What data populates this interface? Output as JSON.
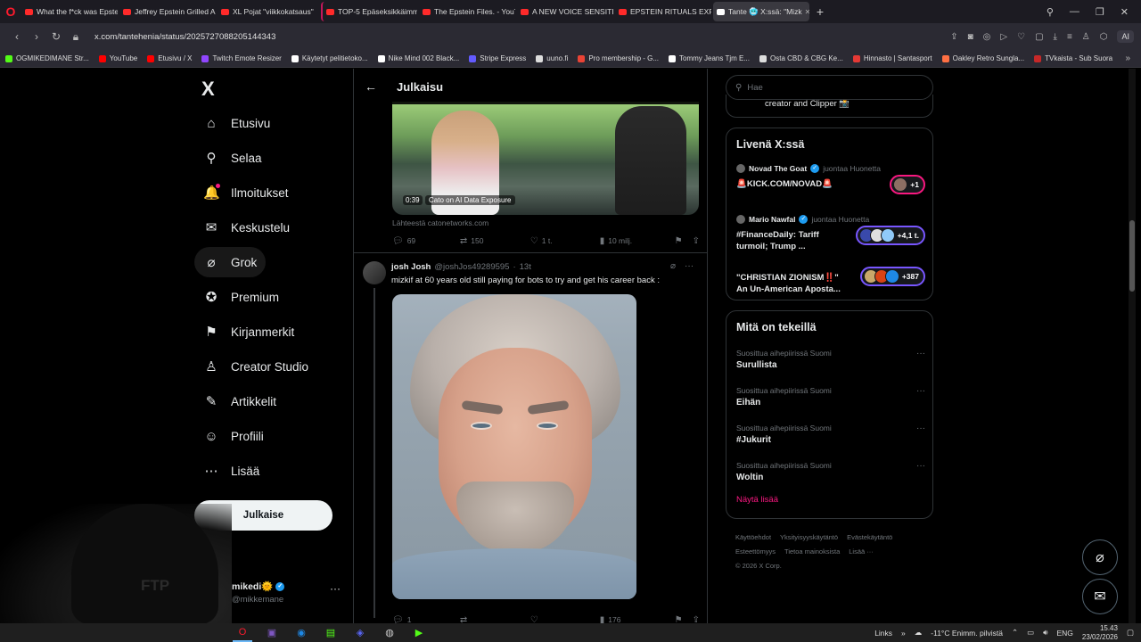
{
  "browser": {
    "tabs": [
      {
        "label": "What the f*ck was Epstein",
        "kind": "yt"
      },
      {
        "label": "Jeffrey Epstein Grilled Abo",
        "kind": "yt"
      },
      {
        "label": "XL Pojat \"viikkokatsaus\" 2",
        "kind": "yt"
      },
      {
        "label": "TOP-5 Epäseksikkäimmät",
        "kind": "yt"
      },
      {
        "label": "The Epstein Files. - YouTu",
        "kind": "yt"
      },
      {
        "label": "A NEW VOICE SENSITIVE S",
        "kind": "yt"
      },
      {
        "label": "EPSTEIN RITUALS EXPOSED",
        "kind": "yt"
      },
      {
        "label": "Tante 🥶 X:ssä: \"Mizk",
        "kind": "x"
      }
    ],
    "new_tab": "+",
    "url": "x.com/tantehenia/status/2025727088205144343",
    "ai_label": "AI",
    "bookmarks": [
      {
        "label": "OGMIKEDIMANE Str...",
        "color": "#53fc18"
      },
      {
        "label": "YouTube",
        "color": "#ff0000"
      },
      {
        "label": "Etusivu / X",
        "color": "#ff0000"
      },
      {
        "label": "Twitch Emote Resizer",
        "color": "#9146ff"
      },
      {
        "label": "Käytetyt pelitietoko...",
        "color": "#ffffff"
      },
      {
        "label": "Nike Mind 002 Black...",
        "color": "#ffffff"
      },
      {
        "label": "Stripe Express",
        "color": "#635bff"
      },
      {
        "label": "uuno.fi",
        "color": "#dddddd"
      },
      {
        "label": "Pro membership - G...",
        "color": "#ea4335"
      },
      {
        "label": "Tommy Jeans Tjm E...",
        "color": "#ffffff"
      },
      {
        "label": "Osta CBD & CBG Ke...",
        "color": "#dddddd"
      },
      {
        "label": "Hinnasto | Santasport",
        "color": "#e53935"
      },
      {
        "label": "Oakley Retro Sungla...",
        "color": "#ff7043"
      },
      {
        "label": "TVkaista - Sub Suora",
        "color": "#c62828"
      }
    ]
  },
  "leftnav": {
    "logo": "X",
    "items": [
      {
        "label": "Etusivu",
        "icon": "home-icon",
        "glyph": "⌂"
      },
      {
        "label": "Selaa",
        "icon": "search-icon",
        "glyph": "⚲"
      },
      {
        "label": "Ilmoitukset",
        "icon": "bell-icon",
        "glyph": "🔔"
      },
      {
        "label": "Keskustelu",
        "icon": "mail-icon",
        "glyph": "✉"
      },
      {
        "label": "Grok",
        "icon": "grok-icon",
        "glyph": "⌀"
      },
      {
        "label": "Premium",
        "icon": "premium-icon",
        "glyph": "✪"
      },
      {
        "label": "Kirjanmerkit",
        "icon": "bookmark-icon",
        "glyph": "⚑"
      },
      {
        "label": "Creator Studio",
        "icon": "creator-studio-icon",
        "glyph": "♙"
      },
      {
        "label": "Artikkelit",
        "icon": "articles-icon",
        "glyph": "✎"
      },
      {
        "label": "Profiili",
        "icon": "profile-icon",
        "glyph": "☺"
      },
      {
        "label": "Lisää",
        "icon": "more-icon",
        "glyph": "⋯"
      }
    ],
    "post_button": "Julkaise",
    "user": {
      "name": "mikedi🌞",
      "handle": "@mikkemane",
      "more": "···"
    }
  },
  "main": {
    "header": "Julkaisu",
    "tweet1": {
      "video_time": "0:39",
      "video_caption": "Cato on AI Data Exposure",
      "source": "Lähteestä catonetworks.com",
      "replies": "69",
      "reposts": "150",
      "likes": "1 t.",
      "views": "10 milj."
    },
    "tweet2": {
      "name": "josh Josh",
      "handle": "@joshJos49289595",
      "time": "13t",
      "text": "mizkif at 60 years old still paying for bots to try and get his career back :",
      "replies": "1",
      "reposts": "",
      "likes": "",
      "views": "176"
    }
  },
  "sidebar": {
    "search_placeholder": "Hae",
    "prev_text": "creator and Clipper 📸",
    "live": {
      "title": "Livenä X:ssä",
      "items": [
        {
          "host": "Novad The Goat",
          "role": "juontaa Huonetta",
          "title": "🚨KICK.COM/NOVAD🚨",
          "count": "+1",
          "pink": true,
          "avatars": [
            "#8d6e63"
          ]
        },
        {
          "host": "Mario Nawfal",
          "role": "juontaa Huonetta",
          "title": "#FinanceDaily: Tariff turmoil; Trump ...",
          "count": "+4,1 t.",
          "pink": false,
          "avatars": [
            "#3949ab",
            "#e0e0e0",
            "#90caf9"
          ]
        },
        {
          "host": "",
          "role": "",
          "title": "\"CHRISTIAN ZIONISM‼️\" An Un-American Aposta...",
          "count": "+387",
          "pink": false,
          "avatars": [
            "#c9a86a",
            "#d84315",
            "#1e88e5"
          ]
        }
      ]
    },
    "trends": {
      "title": "Mitä on tekeillä",
      "items": [
        {
          "category": "Suosittua aihepiirissä Suomi",
          "name": "Surullista"
        },
        {
          "category": "Suosittua aihepiirissä Suomi",
          "name": "Eihän"
        },
        {
          "category": "Suosittua aihepiirissä Suomi",
          "name": "#Jukurit"
        },
        {
          "category": "Suosittua aihepiirissä Suomi",
          "name": "Woltin"
        }
      ],
      "show_more": "Näytä lisää"
    },
    "footer": {
      "links": [
        "Käyttöehdot",
        "Yksityisyyskäytäntö",
        "Evästekäytäntö",
        "Esteettömyys",
        "Tietoa mainoksista",
        "Lisää ···"
      ],
      "copyright": "© 2026 X Corp."
    }
  },
  "webcam": {
    "cap_text": "FTP"
  },
  "taskbar": {
    "links": "Links",
    "weather": "-11°C  Enimm. pilvistä",
    "lang": "ENG",
    "time": "15.43",
    "date": "23/02/2026"
  }
}
